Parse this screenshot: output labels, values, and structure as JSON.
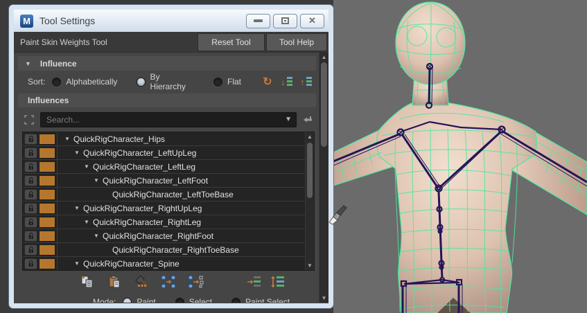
{
  "window": {
    "title": "Tool Settings",
    "app_icon": "maya-logo",
    "app_icon_letter": "M"
  },
  "header": {
    "tool_name": "Paint Skin Weights Tool",
    "reset_button": "Reset Tool",
    "help_button": "Tool Help"
  },
  "influence": {
    "section_title": "Influence",
    "sort": {
      "label": "Sort:",
      "options": [
        {
          "label": "Alphabetically",
          "selected": false
        },
        {
          "label": "By Hierarchy",
          "selected": true
        },
        {
          "label": "Flat",
          "selected": false
        }
      ]
    },
    "toolbar_icons": [
      "refresh-icon",
      "sort-list-descending-icon",
      "sort-list-ascending-icon"
    ],
    "influences_header": "Influences",
    "search": {
      "placeholder": "Search..."
    },
    "tree": [
      {
        "label": "QuickRigCharacter_Hips",
        "indent": 0,
        "expandable": true
      },
      {
        "label": "QuickRigCharacter_LeftUpLeg",
        "indent": 1,
        "expandable": true
      },
      {
        "label": "QuickRigCharacter_LeftLeg",
        "indent": 2,
        "expandable": true
      },
      {
        "label": "QuickRigCharacter_LeftFoot",
        "indent": 3,
        "expandable": true
      },
      {
        "label": "QuickRigCharacter_LeftToeBase",
        "indent": 4,
        "expandable": false
      },
      {
        "label": "QuickRigCharacter_RightUpLeg",
        "indent": 1,
        "expandable": true
      },
      {
        "label": "QuickRigCharacter_RightLeg",
        "indent": 2,
        "expandable": true
      },
      {
        "label": "QuickRigCharacter_RightFoot",
        "indent": 3,
        "expandable": true
      },
      {
        "label": "QuickRigCharacter_RightToeBase",
        "indent": 4,
        "expandable": false
      },
      {
        "label": "QuickRigCharacter_Spine",
        "indent": 1,
        "expandable": true
      }
    ],
    "action_icons": [
      "copy-weights-icon",
      "paste-weights-icon",
      "hammer-weights-icon",
      "move-weights-icon",
      "move-weights-target-icon",
      "show-influenced-icon",
      "expand-list-icon"
    ]
  },
  "mode": {
    "label": "Mode:",
    "options": [
      {
        "label": "Paint",
        "selected": true
      },
      {
        "label": "Select",
        "selected": false
      },
      {
        "label": "Paint Select",
        "selected": false
      }
    ]
  },
  "glyphs": {
    "collapse": "▼",
    "dropdown": "▼",
    "expander": "▼",
    "scroll_up": "▲",
    "scroll_down": "▼",
    "refresh": "↻",
    "arrow_down": "↓",
    "arrow_up": "↑",
    "close": "✕",
    "plus": "+"
  },
  "colors": {
    "accent_orange": "#b5772e",
    "wireframe_green": "#4fe6a2",
    "bone_navy": "#251457",
    "viewport_bg": "#6b6b6b",
    "skin": "#ddc2af"
  },
  "viewport": {
    "cursor_icon": "paint-brush-icon"
  }
}
